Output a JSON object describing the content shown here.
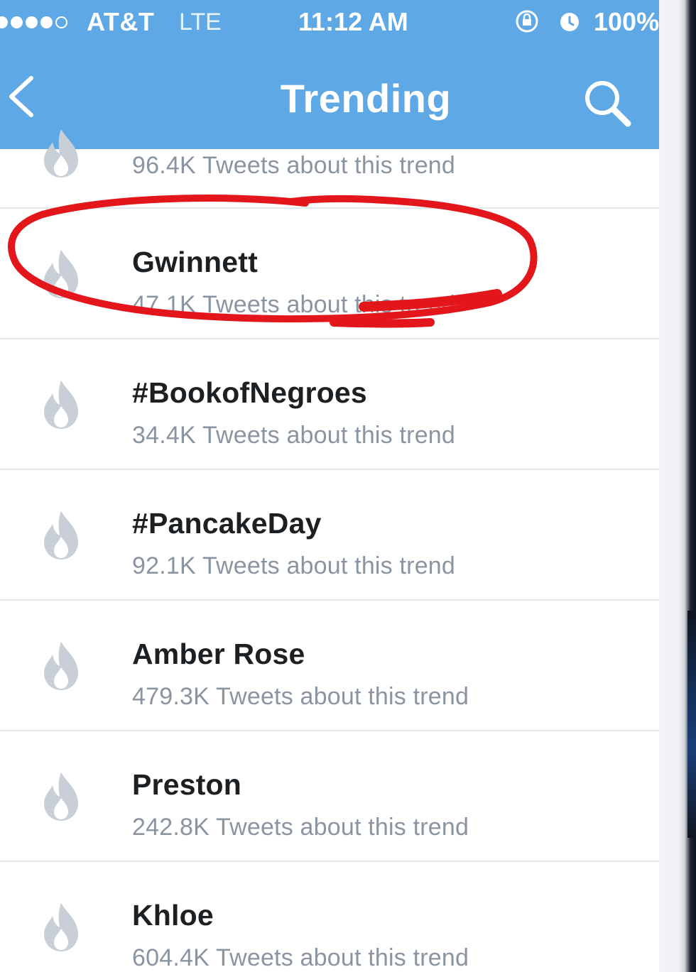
{
  "status_bar": {
    "signal_dots": [
      true,
      true,
      true,
      true,
      false
    ],
    "carrier": "AT&T",
    "network": "LTE",
    "time": "11:12 AM",
    "lock_icon": "orientation-lock-icon",
    "alarm_icon": "alarm-icon",
    "battery": "100%"
  },
  "nav": {
    "back_icon": "chevron-left-icon",
    "title": "Trending",
    "search_icon": "search-icon"
  },
  "partial_row": {
    "meta": "96.4K Tweets about this trend"
  },
  "trends": [
    {
      "title": "Gwinnett",
      "meta": "47.1K Tweets about this trend",
      "highlighted": true
    },
    {
      "title": "#BookofNegroes",
      "meta": "34.4K Tweets about this trend",
      "highlighted": false
    },
    {
      "title": "#PancakeDay",
      "meta": "92.1K Tweets about this trend",
      "highlighted": false
    },
    {
      "title": "Amber Rose",
      "meta": "479.3K Tweets about this trend",
      "highlighted": false
    },
    {
      "title": "Preston",
      "meta": "242.8K Tweets about this trend",
      "highlighted": false
    },
    {
      "title": "Khloe",
      "meta": "604.4K Tweets about this trend",
      "highlighted": false
    }
  ],
  "colors": {
    "nav_bar": "#5ea8e6",
    "title_text": "#1d2023",
    "meta_text": "#8a95a1",
    "flame_icon": "#c8cfd6",
    "annotation_circle": "#e3161b"
  }
}
